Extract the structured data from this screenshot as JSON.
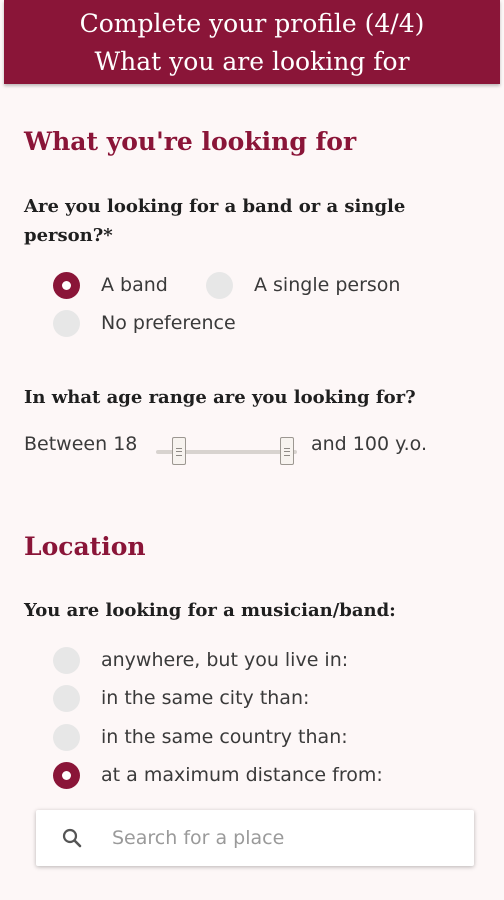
{
  "header": {
    "title_line1": "Complete your profile (4/4)",
    "title_line2": "What you are looking for"
  },
  "looking_for": {
    "title": "What you're looking for",
    "question": "Are you looking for a band or a single person?*",
    "options": [
      {
        "label": "A band",
        "checked": true
      },
      {
        "label": "A single person",
        "checked": false
      },
      {
        "label": "No preference",
        "checked": false
      }
    ]
  },
  "age": {
    "question": "In what age range are you looking for?",
    "prefix": "Between",
    "min": "18",
    "suffix": "and 100 y.o.",
    "max": "100"
  },
  "location": {
    "title": "Location",
    "question": "You are looking for a musician/band:",
    "options": [
      {
        "label": "anywhere, but you live in:",
        "checked": false
      },
      {
        "label": "in the same city than:",
        "checked": false
      },
      {
        "label": "in the same country than:",
        "checked": false
      },
      {
        "label": "at a maximum distance from:",
        "checked": true
      }
    ]
  },
  "search": {
    "placeholder": "Search for a place",
    "icon": "search-icon"
  },
  "colors": {
    "accent": "#8a1538",
    "radio_unchecked": "#e7e7e7",
    "background": "#fdf7f7"
  }
}
